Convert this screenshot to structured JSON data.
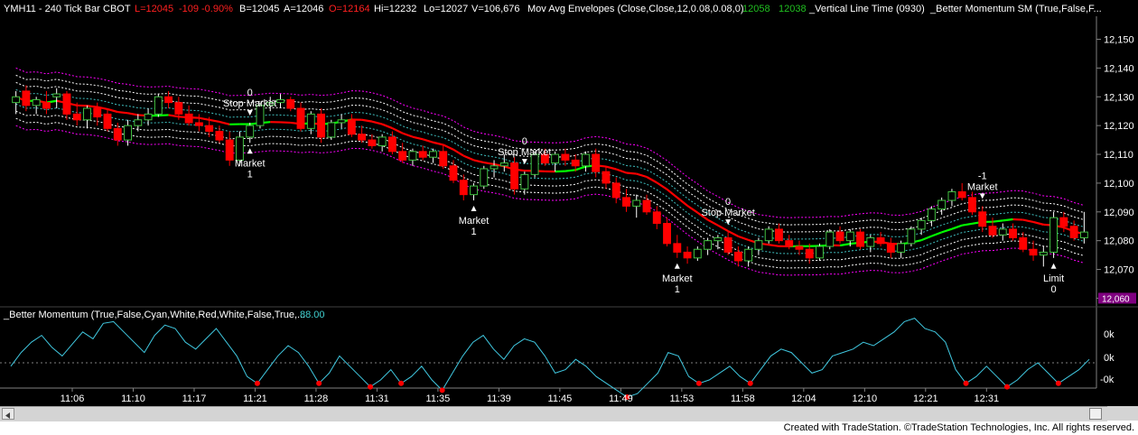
{
  "header": {
    "symbol": "YMH11 - 240 Tick Bar",
    "exchange": "CBOT",
    "last": "L=12045",
    "change": "-109",
    "change_pct": "-0.90%",
    "bid": "B=12045",
    "ask": "A=12046",
    "open": "O=12164",
    "high": "Hi=12232",
    "low": "Lo=12027",
    "volume": "V=106,676",
    "envelope_label": "Mov Avg Envelopes (Close,Close,12,0.08,0.08,0)",
    "envelope_upper": "12058",
    "envelope_lower": "12038",
    "vline_label": "_Vertical Line Time (0930)",
    "momentum_sm_label": "_Better Momentum SM (True,False,F..."
  },
  "lower_panel": {
    "label": "_Better Momentum (True,False,Cyan,White,Red,White,False,True,...",
    "value": "88.00",
    "axis_labels": [
      "0k",
      "0k",
      "-0k"
    ]
  },
  "footer": {
    "text": "Created with TradeStation. ©TradeStation Technologies, Inc. All rights reserved."
  },
  "colors": {
    "background": "#000000",
    "up_bar": "#40c040",
    "down_bar": "#ff0000",
    "ma_line": "#ff0000",
    "ma_line_up": "#00ff00",
    "envelope_outer": "#ff00ff",
    "envelope_inner": "#ffffff",
    "envelope_mid": "#40c0c0",
    "momentum_line": "#40c8e0",
    "last_price_box": "#800080",
    "axis_text": "#ffffff",
    "header_red": "#ff2020",
    "header_green": "#20c020",
    "header_cyan": "#40d0d0"
  },
  "chart_data": {
    "type": "candlestick",
    "x_tick_labels": [
      "11:06",
      "11:10",
      "11:17",
      "11:21",
      "11:28",
      "11:31",
      "11:35",
      "11:39",
      "11:45",
      "11:49",
      "11:53",
      "11:58",
      "12:04",
      "12:10",
      "12:21",
      "12:31"
    ],
    "y_ticks": [
      12060,
      12070,
      12080,
      12090,
      12100,
      12110,
      12120,
      12130,
      12140,
      12150
    ],
    "y_tick_labels": [
      "12,060",
      "12,070",
      "12,080",
      "12,090",
      "12,100",
      "12,110",
      "12,120",
      "12,130",
      "12,140",
      "12,150"
    ],
    "ylim": [
      12057,
      12158
    ],
    "last_price": 12060,
    "last_price_label": "12,060",
    "bars": [
      {
        "o": 12128,
        "h": 12132,
        "l": 12124,
        "c": 12130
      },
      {
        "o": 12132,
        "h": 12134,
        "l": 12125,
        "c": 12127
      },
      {
        "o": 12127,
        "h": 12130,
        "l": 12124,
        "c": 12129
      },
      {
        "o": 12128,
        "h": 12132,
        "l": 12124,
        "c": 12126
      },
      {
        "o": 12130,
        "h": 12133,
        "l": 12126,
        "c": 12131
      },
      {
        "o": 12131,
        "h": 12132,
        "l": 12122,
        "c": 12124
      },
      {
        "o": 12124,
        "h": 12128,
        "l": 12120,
        "c": 12122
      },
      {
        "o": 12122,
        "h": 12127,
        "l": 12119,
        "c": 12126
      },
      {
        "o": 12126,
        "h": 12128,
        "l": 12120,
        "c": 12123
      },
      {
        "o": 12124,
        "h": 12126,
        "l": 12118,
        "c": 12119
      },
      {
        "o": 12119,
        "h": 12121,
        "l": 12113,
        "c": 12115
      },
      {
        "o": 12115,
        "h": 12122,
        "l": 12113,
        "c": 12120
      },
      {
        "o": 12120,
        "h": 12124,
        "l": 12118,
        "c": 12122
      },
      {
        "o": 12122,
        "h": 12126,
        "l": 12120,
        "c": 12124
      },
      {
        "o": 12124,
        "h": 12131,
        "l": 12123,
        "c": 12130
      },
      {
        "o": 12130,
        "h": 12132,
        "l": 12126,
        "c": 12128
      },
      {
        "o": 12128,
        "h": 12130,
        "l": 12122,
        "c": 12124
      },
      {
        "o": 12124,
        "h": 12127,
        "l": 12120,
        "c": 12121
      },
      {
        "o": 12121,
        "h": 12124,
        "l": 12118,
        "c": 12120
      },
      {
        "o": 12120,
        "h": 12123,
        "l": 12116,
        "c": 12118
      },
      {
        "o": 12118,
        "h": 12120,
        "l": 12114,
        "c": 12115
      },
      {
        "o": 12115,
        "h": 12118,
        "l": 12106,
        "c": 12108
      },
      {
        "o": 12108,
        "h": 12118,
        "l": 12106,
        "c": 12116
      },
      {
        "o": 12116,
        "h": 12121,
        "l": 12114,
        "c": 12120
      },
      {
        "o": 12120,
        "h": 12128,
        "l": 12119,
        "c": 12127
      },
      {
        "o": 12127,
        "h": 12130,
        "l": 12125,
        "c": 12128
      },
      {
        "o": 12128,
        "h": 12131,
        "l": 12126,
        "c": 12129
      },
      {
        "o": 12129,
        "h": 12130,
        "l": 12125,
        "c": 12126
      },
      {
        "o": 12126,
        "h": 12128,
        "l": 12118,
        "c": 12119
      },
      {
        "o": 12119,
        "h": 12125,
        "l": 12117,
        "c": 12124
      },
      {
        "o": 12124,
        "h": 12126,
        "l": 12114,
        "c": 12116
      },
      {
        "o": 12116,
        "h": 12122,
        "l": 12115,
        "c": 12121
      },
      {
        "o": 12121,
        "h": 12124,
        "l": 12119,
        "c": 12122
      },
      {
        "o": 12122,
        "h": 12124,
        "l": 12116,
        "c": 12117
      },
      {
        "o": 12117,
        "h": 12120,
        "l": 12114,
        "c": 12115
      },
      {
        "o": 12115,
        "h": 12117,
        "l": 12112,
        "c": 12113
      },
      {
        "o": 12113,
        "h": 12117,
        "l": 12111,
        "c": 12116
      },
      {
        "o": 12116,
        "h": 12118,
        "l": 12110,
        "c": 12111
      },
      {
        "o": 12111,
        "h": 12114,
        "l": 12107,
        "c": 12108
      },
      {
        "o": 12108,
        "h": 12112,
        "l": 12106,
        "c": 12111
      },
      {
        "o": 12111,
        "h": 12113,
        "l": 12108,
        "c": 12109
      },
      {
        "o": 12109,
        "h": 12112,
        "l": 12107,
        "c": 12111
      },
      {
        "o": 12111,
        "h": 12113,
        "l": 12105,
        "c": 12106
      },
      {
        "o": 12106,
        "h": 12108,
        "l": 12100,
        "c": 12101
      },
      {
        "o": 12101,
        "h": 12103,
        "l": 12094,
        "c": 12096
      },
      {
        "o": 12096,
        "h": 12100,
        "l": 12094,
        "c": 12099
      },
      {
        "o": 12099,
        "h": 12106,
        "l": 12098,
        "c": 12105
      },
      {
        "o": 12105,
        "h": 12108,
        "l": 12102,
        "c": 12106
      },
      {
        "o": 12106,
        "h": 12110,
        "l": 12104,
        "c": 12107
      },
      {
        "o": 12107,
        "h": 12109,
        "l": 12096,
        "c": 12098
      },
      {
        "o": 12098,
        "h": 12104,
        "l": 12096,
        "c": 12103
      },
      {
        "o": 12103,
        "h": 12111,
        "l": 12102,
        "c": 12110
      },
      {
        "o": 12110,
        "h": 12112,
        "l": 12106,
        "c": 12107
      },
      {
        "o": 12107,
        "h": 12111,
        "l": 12104,
        "c": 12110
      },
      {
        "o": 12110,
        "h": 12112,
        "l": 12106,
        "c": 12108
      },
      {
        "o": 12108,
        "h": 12110,
        "l": 12104,
        "c": 12106
      },
      {
        "o": 12106,
        "h": 12111,
        "l": 12104,
        "c": 12110
      },
      {
        "o": 12110,
        "h": 12112,
        "l": 12102,
        "c": 12104
      },
      {
        "o": 12104,
        "h": 12106,
        "l": 12098,
        "c": 12100
      },
      {
        "o": 12100,
        "h": 12102,
        "l": 12093,
        "c": 12095
      },
      {
        "o": 12095,
        "h": 12098,
        "l": 12090,
        "c": 12092
      },
      {
        "o": 12092,
        "h": 12096,
        "l": 12088,
        "c": 12094
      },
      {
        "o": 12094,
        "h": 12096,
        "l": 12089,
        "c": 12090
      },
      {
        "o": 12090,
        "h": 12092,
        "l": 12084,
        "c": 12086
      },
      {
        "o": 12086,
        "h": 12088,
        "l": 12078,
        "c": 12079
      },
      {
        "o": 12079,
        "h": 12082,
        "l": 12074,
        "c": 12076
      },
      {
        "o": 12076,
        "h": 12078,
        "l": 12072,
        "c": 12074
      },
      {
        "o": 12074,
        "h": 12078,
        "l": 12073,
        "c": 12077
      },
      {
        "o": 12077,
        "h": 12081,
        "l": 12075,
        "c": 12080
      },
      {
        "o": 12080,
        "h": 12082,
        "l": 12077,
        "c": 12081
      },
      {
        "o": 12081,
        "h": 12083,
        "l": 12075,
        "c": 12076
      },
      {
        "o": 12076,
        "h": 12078,
        "l": 12071,
        "c": 12073
      },
      {
        "o": 12073,
        "h": 12078,
        "l": 12071,
        "c": 12077
      },
      {
        "o": 12077,
        "h": 12081,
        "l": 12075,
        "c": 12080
      },
      {
        "o": 12080,
        "h": 12085,
        "l": 12079,
        "c": 12084
      },
      {
        "o": 12084,
        "h": 12086,
        "l": 12079,
        "c": 12080
      },
      {
        "o": 12080,
        "h": 12082,
        "l": 12077,
        "c": 12078
      },
      {
        "o": 12078,
        "h": 12080,
        "l": 12075,
        "c": 12077
      },
      {
        "o": 12077,
        "h": 12079,
        "l": 12072,
        "c": 12074
      },
      {
        "o": 12074,
        "h": 12079,
        "l": 12073,
        "c": 12078
      },
      {
        "o": 12078,
        "h": 12084,
        "l": 12077,
        "c": 12083
      },
      {
        "o": 12083,
        "h": 12085,
        "l": 12079,
        "c": 12080
      },
      {
        "o": 12080,
        "h": 12084,
        "l": 12078,
        "c": 12083
      },
      {
        "o": 12083,
        "h": 12084,
        "l": 12077,
        "c": 12078
      },
      {
        "o": 12078,
        "h": 12082,
        "l": 12076,
        "c": 12081
      },
      {
        "o": 12081,
        "h": 12083,
        "l": 12078,
        "c": 12079
      },
      {
        "o": 12079,
        "h": 12081,
        "l": 12074,
        "c": 12076
      },
      {
        "o": 12076,
        "h": 12080,
        "l": 12074,
        "c": 12079
      },
      {
        "o": 12079,
        "h": 12085,
        "l": 12078,
        "c": 12084
      },
      {
        "o": 12084,
        "h": 12088,
        "l": 12082,
        "c": 12087
      },
      {
        "o": 12087,
        "h": 12092,
        "l": 12085,
        "c": 12091
      },
      {
        "o": 12091,
        "h": 12095,
        "l": 12089,
        "c": 12094
      },
      {
        "o": 12094,
        "h": 12098,
        "l": 12092,
        "c": 12097
      },
      {
        "o": 12097,
        "h": 12100,
        "l": 12094,
        "c": 12095
      },
      {
        "o": 12095,
        "h": 12097,
        "l": 12089,
        "c": 12090
      },
      {
        "o": 12090,
        "h": 12092,
        "l": 12083,
        "c": 12085
      },
      {
        "o": 12085,
        "h": 12088,
        "l": 12081,
        "c": 12082
      },
      {
        "o": 12082,
        "h": 12086,
        "l": 12080,
        "c": 12084
      },
      {
        "o": 12084,
        "h": 12086,
        "l": 12080,
        "c": 12081
      },
      {
        "o": 12081,
        "h": 12083,
        "l": 12076,
        "c": 12077
      },
      {
        "o": 12077,
        "h": 12080,
        "l": 12073,
        "c": 12075
      },
      {
        "o": 12075,
        "h": 12078,
        "l": 12071,
        "c": 12076
      },
      {
        "o": 12076,
        "h": 12090,
        "l": 12074,
        "c": 12088
      },
      {
        "o": 12088,
        "h": 12090,
        "l": 12083,
        "c": 12085
      },
      {
        "o": 12085,
        "h": 12087,
        "l": 12080,
        "c": 12081
      },
      {
        "o": 12081,
        "h": 12090,
        "l": 12079,
        "c": 12083
      }
    ],
    "orders": [
      {
        "bar": 23,
        "label": "0",
        "sub": "Stop Market",
        "dir": "down",
        "pos": "above"
      },
      {
        "bar": 23,
        "label": "Market",
        "sub": "1",
        "dir": "up",
        "pos": "below"
      },
      {
        "bar": 50,
        "label": "0",
        "sub": "Stop Market",
        "dir": "down",
        "pos": "above"
      },
      {
        "bar": 45,
        "label": "Market",
        "sub": "1",
        "dir": "up",
        "pos": "below"
      },
      {
        "bar": 70,
        "label": "0",
        "sub": "Stop Market",
        "dir": "down",
        "pos": "above"
      },
      {
        "bar": 65,
        "label": "Market",
        "sub": "1",
        "dir": "up",
        "pos": "below"
      },
      {
        "bar": 95,
        "label": "-1",
        "sub": "Market",
        "dir": "down",
        "pos": "above"
      },
      {
        "bar": 102,
        "label": "Limit",
        "sub": "0",
        "dir": "up",
        "pos": "below"
      }
    ]
  },
  "momentum_data": {
    "type": "line",
    "values": [
      -10,
      30,
      60,
      80,
      45,
      20,
      55,
      90,
      70,
      115,
      120,
      90,
      60,
      30,
      80,
      110,
      100,
      60,
      40,
      70,
      100,
      60,
      20,
      -40,
      -60,
      -20,
      20,
      50,
      30,
      -10,
      -60,
      -30,
      20,
      -10,
      -40,
      -70,
      -50,
      -20,
      -60,
      -40,
      -10,
      -50,
      -80,
      -30,
      20,
      60,
      80,
      40,
      10,
      50,
      70,
      60,
      20,
      -30,
      -20,
      10,
      -10,
      -40,
      -60,
      -80,
      -100,
      -90,
      -60,
      -30,
      30,
      20,
      -40,
      -60,
      -50,
      -30,
      -10,
      -40,
      -60,
      -20,
      20,
      40,
      30,
      0,
      -30,
      -20,
      20,
      30,
      40,
      60,
      50,
      70,
      90,
      120,
      130,
      100,
      90,
      60,
      -20,
      -60,
      -40,
      -10,
      -40,
      -70,
      -50,
      -20,
      0,
      -30,
      -60,
      -40,
      -20,
      10
    ]
  }
}
